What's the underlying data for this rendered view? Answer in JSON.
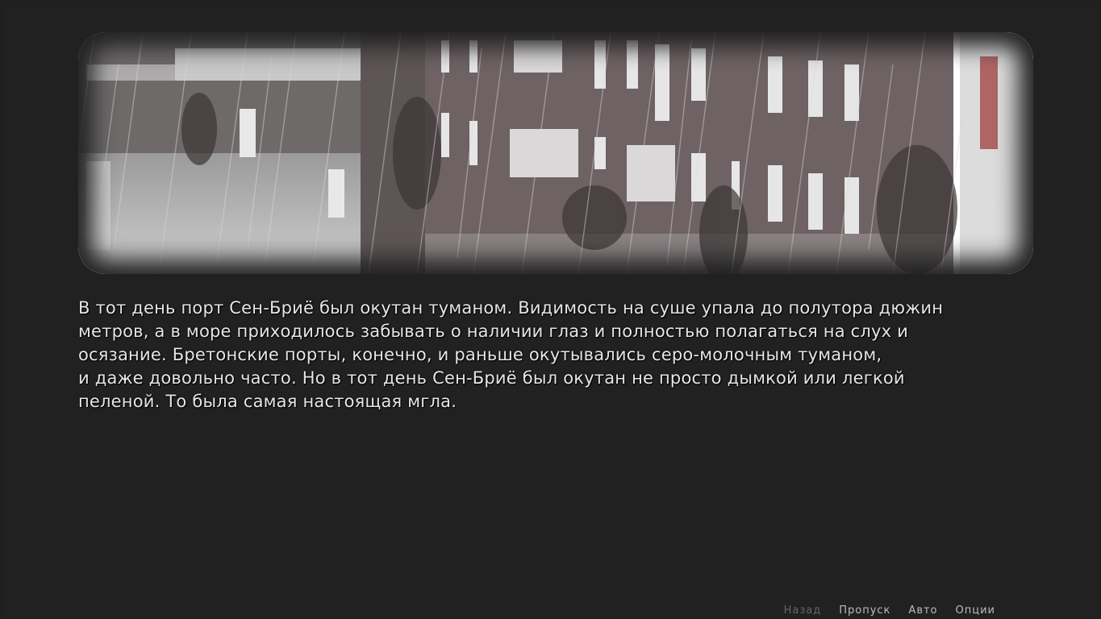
{
  "narration": {
    "lines": [
      "В тот день порт Сен-Бриё был окутан туманом. Видимость на суше упала до полутора дюжин",
      "метров, а в море приходилось забывать о наличии глаз и полностью полагаться на слух и",
      "осязание. Бретонские порты, конечно, и раньше окутывались серо-молочным туманом,",
      "и даже довольно часто. Но в тот день Сен-Бриё был окутан не просто дымкой или легкой",
      "пеленой. То была самая настоящая мгла."
    ]
  },
  "quick_menu": {
    "back": "Назад",
    "skip": "Пропуск",
    "auto": "Авто",
    "options": "Опции"
  },
  "colors": {
    "background": "#212121",
    "text": "#e6e6e6",
    "menu_active": "#bdbdbd",
    "menu_disabled": "#666666"
  },
  "scene": {
    "icon": "rainy-street-illustration"
  }
}
